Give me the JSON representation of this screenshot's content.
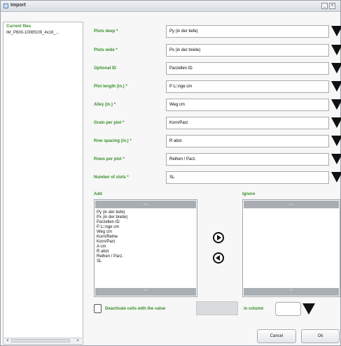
{
  "window": {
    "title": "Import",
    "minimize": "_",
    "close": "x"
  },
  "files": {
    "title": "Current files",
    "items": [
      "IM_P600-1006f109_4x16_..."
    ],
    "scroll_left": "◂",
    "scroll_right": "▸"
  },
  "fields": [
    {
      "label": "Plots deep *",
      "value": "Py (in der tiefe)"
    },
    {
      "label": "Plots wide *",
      "value": "Px (in der breite)"
    },
    {
      "label": "Optional ID",
      "value": "Parzellen ID"
    },
    {
      "label": "Plot length (in.) *",
      "value": "P L□nge cm"
    },
    {
      "label": "Alley (in.) *",
      "value": "Weg cm"
    },
    {
      "label": "Grain per plot *",
      "value": "Korn/Parz"
    },
    {
      "label": "Row spacing (in.) *",
      "value": "R abst"
    },
    {
      "label": "Rows per plot *",
      "value": "Reihen / Parz."
    },
    {
      "label": "Number of slots *",
      "value": "SL"
    }
  ],
  "add_list": {
    "label": "Add",
    "items": [
      "Py (in der tiefe)",
      "Px (in der breite)",
      "Parzellen ID",
      "P L□nge cm",
      "Weg cm",
      "Korn/Reihe",
      "Korn/Parz",
      "A cm",
      "R abst",
      "Reihen / Parz.",
      "SL"
    ],
    "up_icon": "︽",
    "down_icon": "︾"
  },
  "ignore_list": {
    "label": "Ignore",
    "items": [],
    "up_icon": "︽",
    "down_icon": "︾"
  },
  "deactivate": {
    "checkbox_label": "Deactivate cells with the value",
    "value": "",
    "column_label": "in column",
    "column_value": ""
  },
  "buttons": {
    "cancel": "Cancel",
    "ok": "Ok"
  }
}
